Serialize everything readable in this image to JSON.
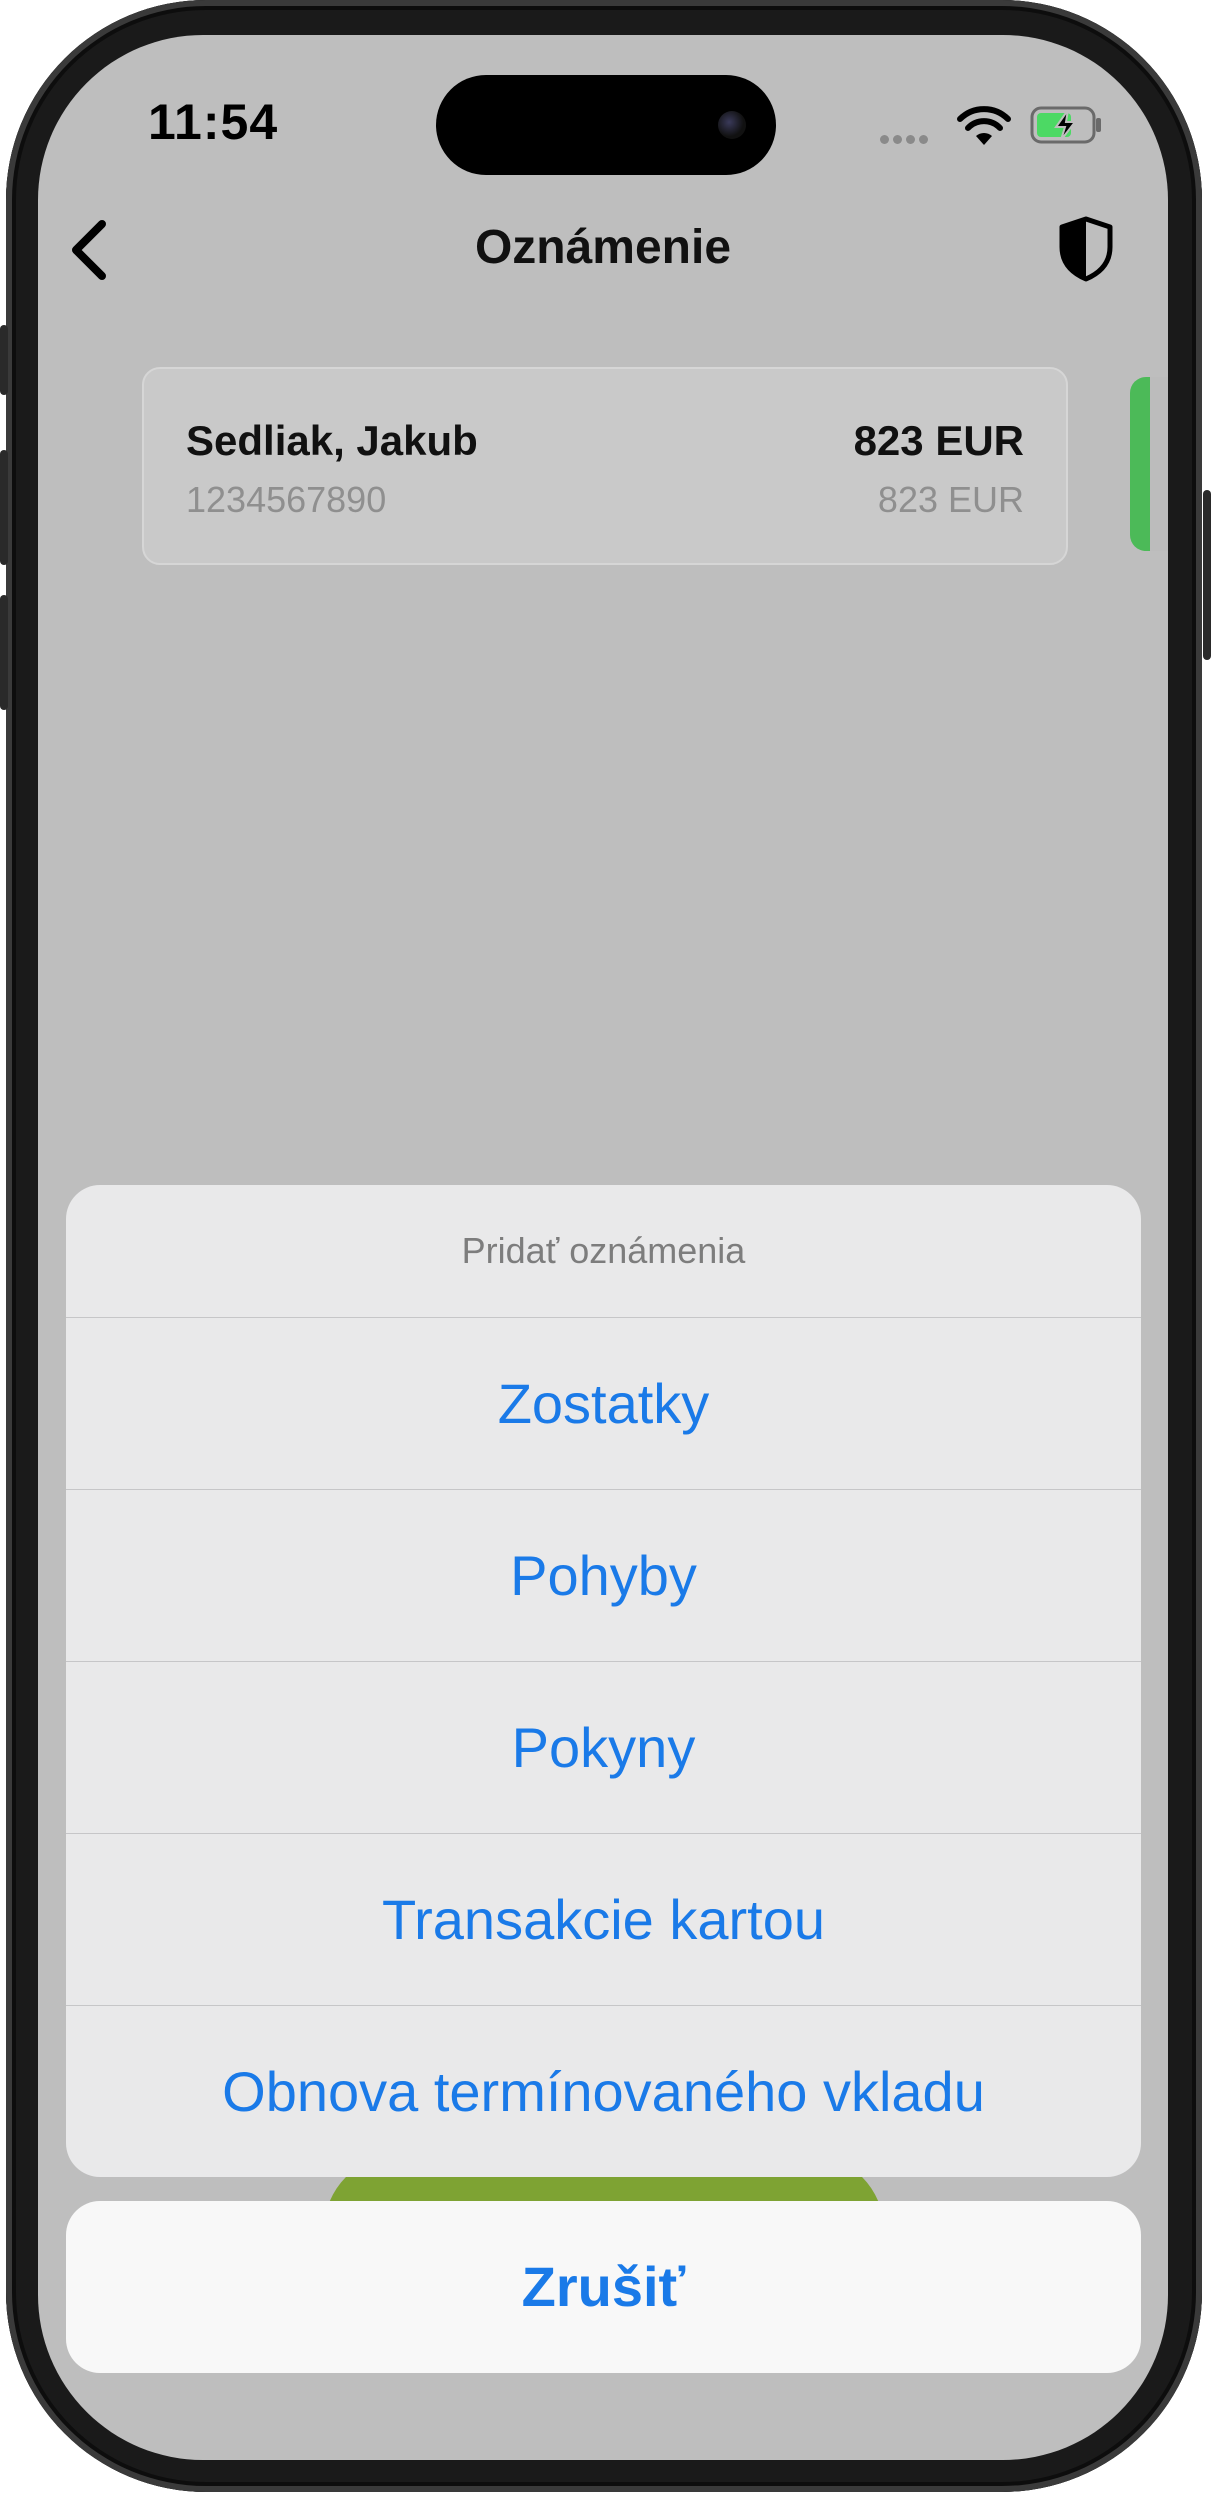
{
  "status_bar": {
    "time": "11:54",
    "wifi_icon": "wifi-icon",
    "battery_icon": "battery-charging-icon"
  },
  "nav": {
    "back_icon": "chevron-left-icon",
    "title": "Oznámenie",
    "shield_icon": "shield-icon"
  },
  "account": {
    "name": "Sedliak, Jakub",
    "number": "1234567890",
    "balance": "823 EUR",
    "available": "823 EUR"
  },
  "action_sheet": {
    "title": "Pridať oznámenia",
    "items": [
      {
        "label": "Zostatky"
      },
      {
        "label": "Pohyby"
      },
      {
        "label": "Pokyny"
      },
      {
        "label": "Transakcie kartou"
      },
      {
        "label": "Obnova termínovaného vkladu"
      }
    ],
    "cancel_label": "Zrušiť"
  },
  "colors": {
    "accent_blue": "#1a7ae8",
    "brand_green": "#7ea333",
    "card_indicator_green": "#4cba58",
    "overlay_gray": "#bebebe"
  }
}
